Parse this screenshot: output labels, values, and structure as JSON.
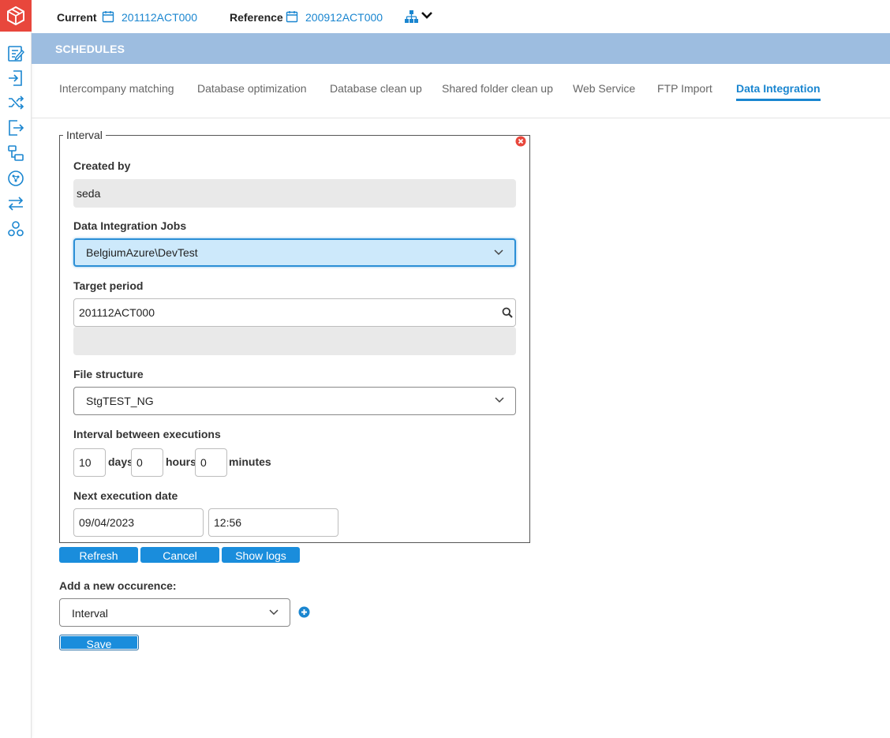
{
  "header": {
    "current_label": "Current",
    "current_value": "201112ACT000",
    "reference_label": "Reference",
    "reference_value": "200912ACT000"
  },
  "section": {
    "title": "SCHEDULES"
  },
  "tabs": [
    {
      "label": "Intercompany matching",
      "active": false
    },
    {
      "label": "Database optimization",
      "active": false
    },
    {
      "label": "Database clean up",
      "active": false
    },
    {
      "label": "Shared folder clean up",
      "active": false
    },
    {
      "label": "Web Service",
      "active": false
    },
    {
      "label": "FTP Import",
      "active": false
    },
    {
      "label": "Data Integration",
      "active": true
    }
  ],
  "form": {
    "legend": "Interval",
    "created_by_label": "Created by",
    "created_by_value": "seda",
    "jobs_label": "Data Integration Jobs",
    "jobs_value": "BelgiumAzure\\DevTest",
    "target_period_label": "Target period",
    "target_period_value": "201112ACT000",
    "target_period_description": "",
    "file_structure_label": "File structure",
    "file_structure_value": "StgTEST_NG",
    "interval_label": "Interval between executions",
    "days_value": "10",
    "days_label": "days",
    "hours_value": "0",
    "hours_label": "hours",
    "minutes_value": "0",
    "minutes_label": "minutes",
    "next_exec_label": "Next execution date",
    "next_exec_date": "09/04/2023",
    "next_exec_time": "12:56"
  },
  "actions": {
    "refresh": "Refresh",
    "cancel": "Cancel",
    "show_logs": "Show logs"
  },
  "occurrence": {
    "label": "Add a new occurence:",
    "value": "Interval",
    "save": "Save"
  },
  "colors": {
    "accent": "#1a86d0",
    "logo": "#e8473c",
    "band": "#9dbde0",
    "focused_select": "#cde9fb"
  },
  "icons": {
    "sidebar": [
      "report-edit-icon",
      "sign-in-icon",
      "shuffle-icon",
      "sign-out-icon",
      "flow-icon",
      "globe-network-icon",
      "transfer-icon",
      "cluster-icon"
    ]
  }
}
